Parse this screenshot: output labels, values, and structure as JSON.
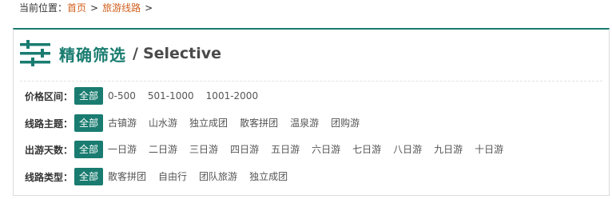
{
  "breadcrumb": {
    "prefix": "当前位置：",
    "home": "首页",
    "sep1": ">",
    "current": "旅游线路",
    "sep2": ">"
  },
  "header": {
    "icon": "filter-sliders-icon",
    "title_cn": "精确筛选",
    "slash": "/",
    "title_en": "Selective"
  },
  "accent_color": "#1a7c70",
  "link_color": "#d0601e",
  "filters": [
    {
      "label": "价格区间：",
      "options": [
        "全部",
        "0-500",
        "501-1000",
        "1001-2000"
      ],
      "selected": 0
    },
    {
      "label": "线路主题：",
      "options": [
        "全部",
        "古镇游",
        "山水游",
        "独立成团",
        "散客拼团",
        "温泉游",
        "团购游"
      ],
      "selected": 0
    },
    {
      "label": "出游天数：",
      "options": [
        "全部",
        "一日游",
        "二日游",
        "三日游",
        "四日游",
        "五日游",
        "六日游",
        "七日游",
        "八日游",
        "九日游",
        "十日游"
      ],
      "selected": 0
    },
    {
      "label": "线路类型：",
      "options": [
        "全部",
        "散客拼团",
        "自由行",
        "团队旅游",
        "独立成团"
      ],
      "selected": 0
    }
  ]
}
